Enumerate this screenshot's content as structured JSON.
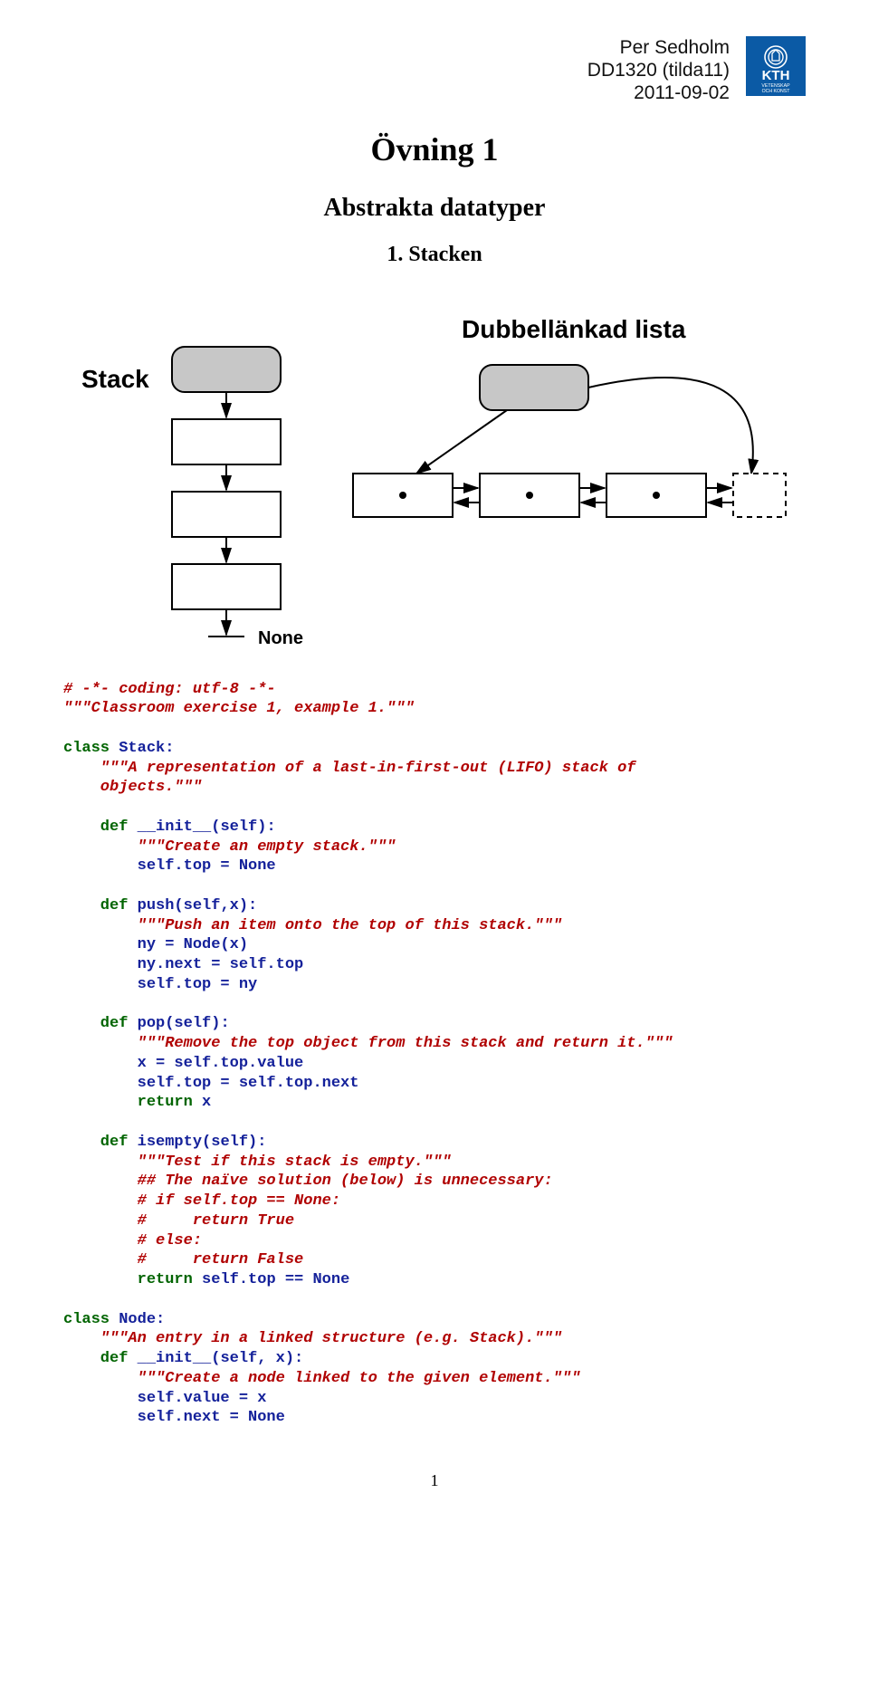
{
  "header": {
    "author": "Per Sedholm",
    "course": "DD1320 (tilda11)",
    "date": "2011-09-02"
  },
  "titles": {
    "main": "Övning 1",
    "sub": "Abstrakta datatyper",
    "section": "1. Stacken"
  },
  "diagram": {
    "stack_label": "Stack",
    "dll_label": "Dubbellänkad lista",
    "none_label": "None"
  },
  "code": {
    "l1": "# -*- coding: utf-8 -*-",
    "l2": "\"\"\"Classroom exercise 1, example 1.\"\"\"",
    "l3": "class",
    "l4": " Stack:",
    "l5": "    \"\"\"A representation of a last-in-first-out (LIFO) stack of",
    "l6": "    objects.\"\"\"",
    "l7": "    def",
    "l8": " __init__(self):",
    "l9": "        \"\"\"Create an empty stack.\"\"\"",
    "l10": "        self.top = None",
    "l11": "    def",
    "l12": " push(self,x):",
    "l13": "        \"\"\"Push an item onto the top of this stack.\"\"\"",
    "l14": "        ny = Node(x)",
    "l15": "        ny.next = self.top",
    "l16": "        self.top = ny",
    "l17": "    def",
    "l18": " pop(self):",
    "l19": "        \"\"\"Remove the top object from this stack and return it.\"\"\"",
    "l20": "        x = self.top.value",
    "l21": "        self.top = self.top.next",
    "l22a": "        ",
    "l22b": "return",
    "l22c": " x",
    "l23": "    def",
    "l24": " isempty(self):",
    "l25": "        \"\"\"Test if this stack is empty.\"\"\"",
    "l26": "        ## The naïve solution (below) is unnecessary:",
    "l27": "        # if self.top == None:",
    "l28": "        #     return True",
    "l29": "        # else:",
    "l30": "        #     return False",
    "l31a": "        ",
    "l31b": "return",
    "l31c": " self.top == None",
    "l32": "class",
    "l33": " Node:",
    "l34": "    \"\"\"An entry in a linked structure (e.g. Stack).\"\"\"",
    "l35": "    def",
    "l36": " __init__(self, x):",
    "l37": "        \"\"\"Create a node linked to the given element.\"\"\"",
    "l38": "        self.value = x",
    "l39": "        self.next = None"
  },
  "page_number": "1"
}
